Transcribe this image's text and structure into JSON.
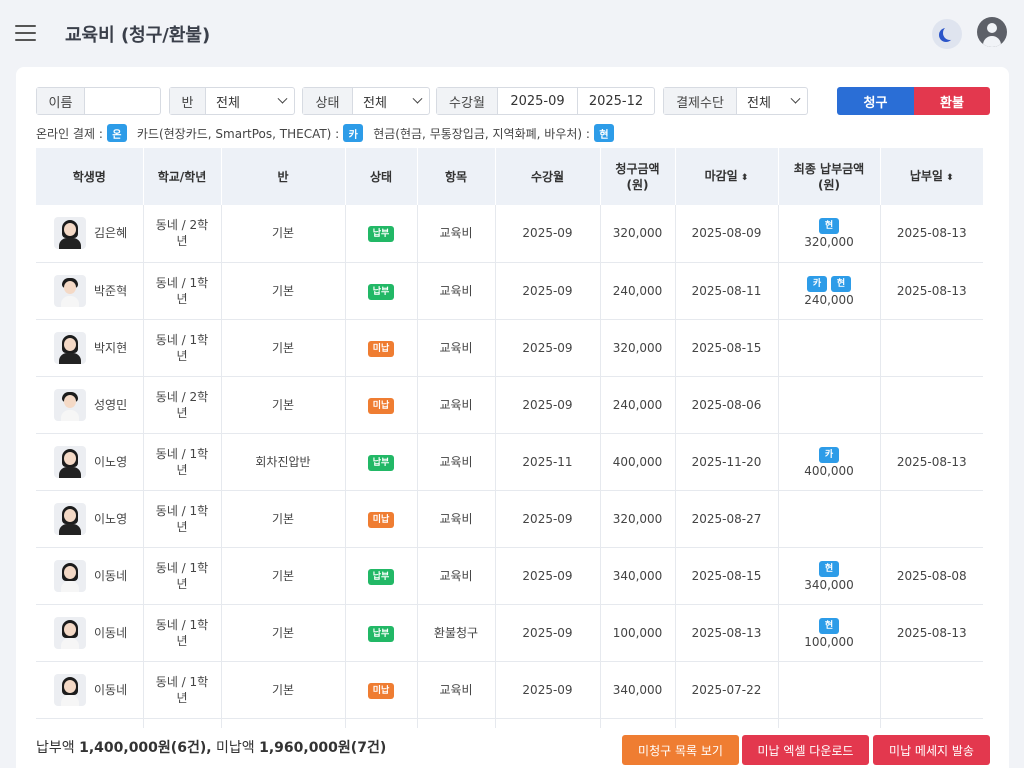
{
  "header": {
    "title": "교육비 (청구/환불)",
    "theme_icon": "moon-icon",
    "profile_icon": "user-icon"
  },
  "filters": {
    "name_label": "이름",
    "name_value": "",
    "class_label": "반",
    "class_value": "전체",
    "status_label": "상태",
    "status_value": "전체",
    "month_label": "수강월",
    "month_from": "2025-09",
    "month_to": "2025-12",
    "payment_label": "결제수단",
    "payment_value": "전체"
  },
  "actions": {
    "claim_label": "청구",
    "refund_label": "환불",
    "claim_color": "#2a6ed6",
    "refund_color": "#e3384e"
  },
  "legend": {
    "online_text": "온라인 결제 :",
    "online_chip": "온",
    "card_text": "카드(현장카드, SmartPos, THECAT) :",
    "card_chip": "카",
    "cash_text": "현금(현금, 무통장입금, 지역화폐, 바우처) :",
    "cash_chip": "현"
  },
  "table": {
    "columns": [
      "학생명",
      "학교/학년",
      "반",
      "상태",
      "항목",
      "수강월",
      "청구금액\n(원)",
      "마감일",
      "최종 납부금액\n(원)",
      "납부일"
    ],
    "sortable": [
      "마감일",
      "납부일"
    ],
    "status_colors": {
      "납부": "#22b866",
      "미납": "#ef7d32"
    },
    "rows": [
      {
        "name": "김은혜",
        "photo": "female",
        "school": "동네 / 2학\n년",
        "class": "기본",
        "status": "납부",
        "item": "교육비",
        "month": "2025-09",
        "amount": "320,000",
        "due": "2025-08-09",
        "methods": [
          "현"
        ],
        "paid": "320,000",
        "paid_date": "2025-08-13"
      },
      {
        "name": "박준혁",
        "photo": "male",
        "school": "동네 / 1학\n년",
        "class": "기본",
        "status": "납부",
        "item": "교육비",
        "month": "2025-09",
        "amount": "240,000",
        "due": "2025-08-11",
        "methods": [
          "카",
          "현"
        ],
        "paid": "240,000",
        "paid_date": "2025-08-13"
      },
      {
        "name": "박지현",
        "photo": "female",
        "school": "동네 / 1학\n년",
        "class": "기본",
        "status": "미납",
        "item": "교육비",
        "month": "2025-09",
        "amount": "320,000",
        "due": "2025-08-15",
        "methods": [],
        "paid": "",
        "paid_date": ""
      },
      {
        "name": "성영민",
        "photo": "male",
        "school": "동네 / 2학\n년",
        "class": "기본",
        "status": "미납",
        "item": "교육비",
        "month": "2025-09",
        "amount": "240,000",
        "due": "2025-08-06",
        "methods": [],
        "paid": "",
        "paid_date": ""
      },
      {
        "name": "이노영",
        "photo": "suit",
        "school": "동네 / 1학\n년",
        "class": "회차진압반",
        "status": "납부",
        "item": "교육비",
        "month": "2025-11",
        "amount": "400,000",
        "due": "2025-11-20",
        "methods": [
          "카"
        ],
        "paid": "400,000",
        "paid_date": "2025-08-13"
      },
      {
        "name": "이노영",
        "photo": "suit",
        "school": "동네 / 1학\n년",
        "class": "기본",
        "status": "미납",
        "item": "교육비",
        "month": "2025-09",
        "amount": "320,000",
        "due": "2025-08-27",
        "methods": [],
        "paid": "",
        "paid_date": ""
      },
      {
        "name": "이동네",
        "photo": "female-white",
        "school": "동네 / 1학\n년",
        "class": "기본",
        "status": "납부",
        "item": "교육비",
        "month": "2025-09",
        "amount": "340,000",
        "due": "2025-08-15",
        "methods": [
          "현"
        ],
        "paid": "340,000",
        "paid_date": "2025-08-08"
      },
      {
        "name": "이동네",
        "photo": "female-white",
        "school": "동네 / 1학\n년",
        "class": "기본",
        "status": "납부",
        "item": "환불청구",
        "month": "2025-09",
        "amount": "100,000",
        "due": "2025-08-13",
        "methods": [
          "현"
        ],
        "paid": "100,000",
        "paid_date": "2025-08-13"
      },
      {
        "name": "이동네",
        "photo": "female-white",
        "school": "동네 / 1학\n년",
        "class": "기본",
        "status": "미납",
        "item": "교육비",
        "month": "2025-09",
        "amount": "340,000",
        "due": "2025-07-22",
        "methods": [],
        "paid": "",
        "paid_date": ""
      },
      {
        "name": "",
        "photo": "female",
        "school": "",
        "class": "",
        "status": "",
        "item": "",
        "month": "",
        "amount": "",
        "due": "",
        "methods": [],
        "paid": "",
        "paid_date": ""
      }
    ]
  },
  "footer": {
    "paid_label": "납부액",
    "paid_value": "1,400,000원(6건),",
    "unpaid_label": "미납액",
    "unpaid_value": "1,960,000원(7건)",
    "unbilled_btn": "미청구 목록 보기",
    "excel_btn": "미납 엑셀 다운로드",
    "message_btn": "미납 메세지 발송",
    "unbilled_color": "#ef7d32",
    "excel_color": "#e3384e",
    "message_color": "#e3384e"
  }
}
